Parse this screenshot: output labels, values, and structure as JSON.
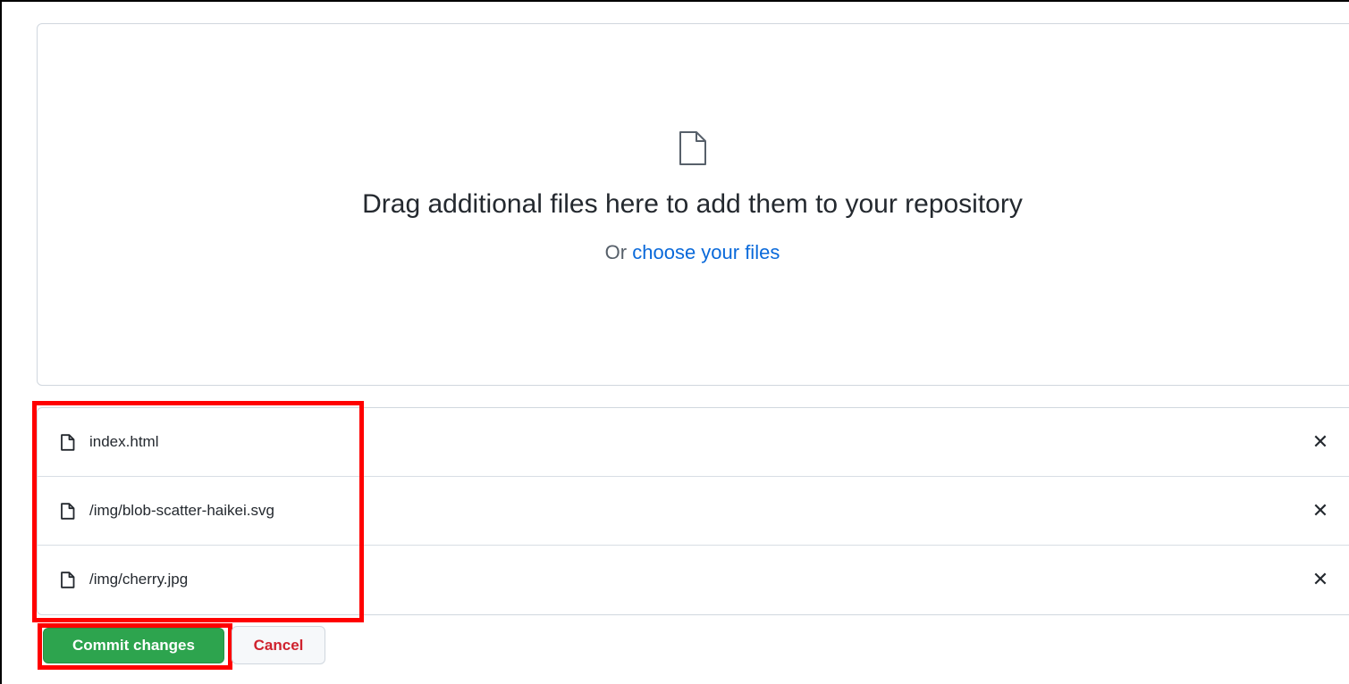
{
  "dropzone": {
    "icon": "file-icon",
    "title": "Drag additional files here to add them to your repository",
    "sub_prefix": "Or",
    "sub_link": "choose your files"
  },
  "files": [
    {
      "name": "index.html",
      "icon": "file-icon",
      "remove_icon": "close-icon"
    },
    {
      "name": "/img/blob-scatter-haikei.svg",
      "icon": "file-icon",
      "remove_icon": "close-icon"
    },
    {
      "name": "/img/cherry.jpg",
      "icon": "file-icon",
      "remove_icon": "close-icon"
    }
  ],
  "actions": {
    "commit_label": "Commit changes",
    "cancel_label": "Cancel"
  },
  "colors": {
    "commit_bg": "#2da44e",
    "cancel_text": "#cf222e",
    "link": "#0969da",
    "annotation": "#ff0000"
  }
}
